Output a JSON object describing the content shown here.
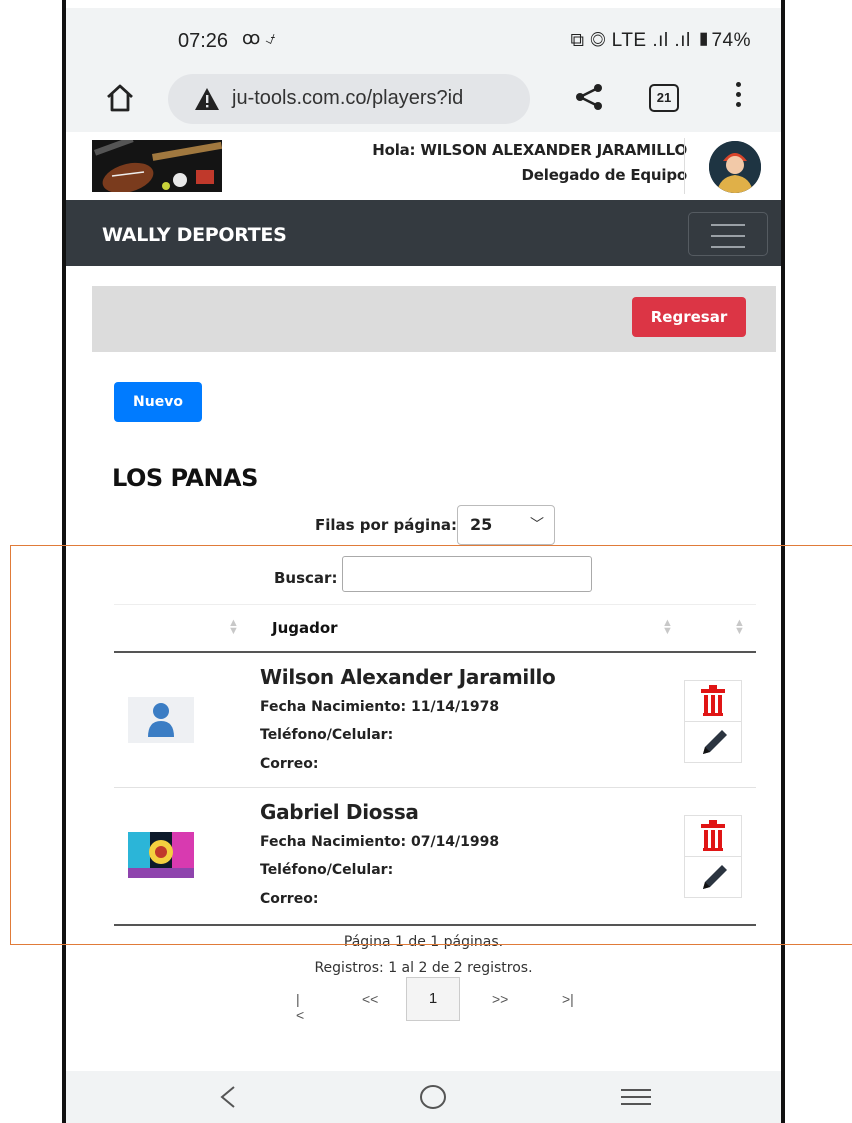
{
  "status_bar": {
    "time": "07:26",
    "indicators": "LTE .ıl .ıl",
    "battery": "74%"
  },
  "browser": {
    "url": "ju-tools.com.co/players?id",
    "tab_count": "21"
  },
  "header": {
    "greeting": "Hola: WILSON ALEXANDER JARAMILLO",
    "role": "Delegado de Equipo"
  },
  "navbar": {
    "brand": "WALLY DEPORTES"
  },
  "actions": {
    "back_label": "Regresar",
    "new_label": "Nuevo"
  },
  "team": {
    "name": "LOS PANAS"
  },
  "controls": {
    "rows_label": "Filas por página:",
    "rows_value": "25",
    "search_label": "Buscar:",
    "search_value": ""
  },
  "table": {
    "header": "Jugador",
    "rows": [
      {
        "name": "Wilson Alexander Jaramillo",
        "birth": "Fecha Nacimiento: 11/14/1978",
        "phone": "Teléfono/Celular:",
        "email": "Correo:"
      },
      {
        "name": "Gabriel Diossa",
        "birth": "Fecha Nacimiento: 07/14/1998",
        "phone": "Teléfono/Celular:",
        "email": "Correo:"
      }
    ]
  },
  "pagination": {
    "page_info": "Página 1 de 1 páginas.",
    "records_info": "Registros: 1 al 2 de 2 registros.",
    "first": "|<",
    "prev": "<<",
    "current": "1",
    "next": ">>",
    "last": ">|"
  },
  "colors": {
    "danger": "#dc3545",
    "primary": "#007bff",
    "navbar": "#343a40",
    "highlight": "#e07b39"
  }
}
